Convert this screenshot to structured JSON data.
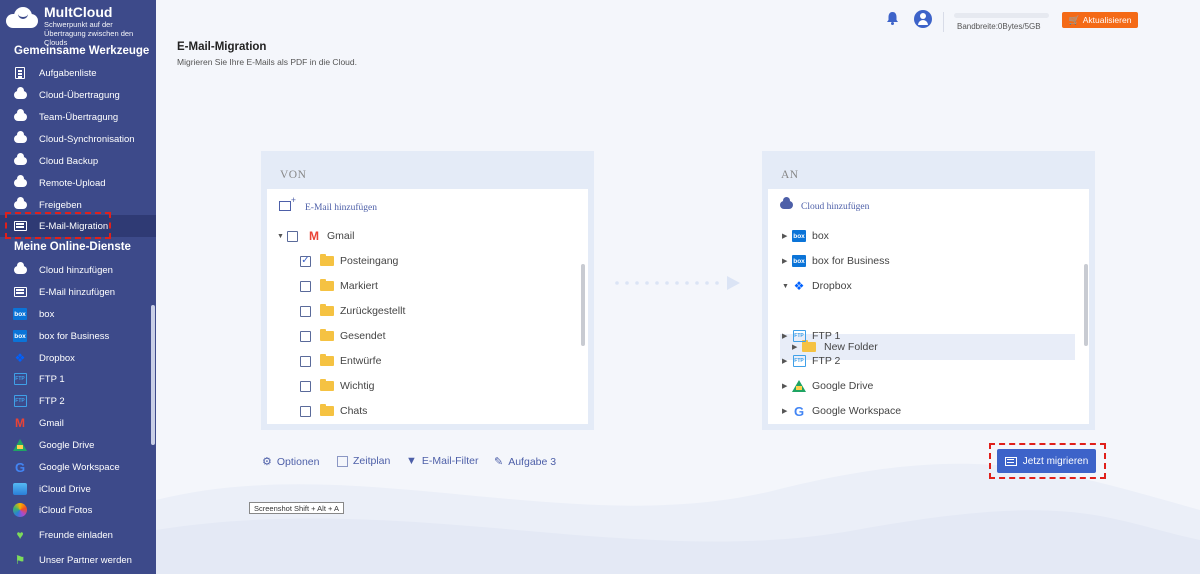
{
  "app": {
    "logo_title": "MultCloud",
    "logo_subtitle": "Schwerpunkt auf der Übertragung zwischen den Clouds"
  },
  "sidebar": {
    "section1_title": "Gemeinsame Werkzeuge",
    "tools": [
      {
        "label": "Aufgabenliste",
        "icon": "task-list-icon"
      },
      {
        "label": "Cloud-Übertragung",
        "icon": "cloud-transfer-icon"
      },
      {
        "label": "Team-Übertragung",
        "icon": "team-transfer-icon"
      },
      {
        "label": "Cloud-Synchronisation",
        "icon": "cloud-sync-icon"
      },
      {
        "label": "Cloud Backup",
        "icon": "cloud-backup-icon"
      },
      {
        "label": "Remote-Upload",
        "icon": "remote-upload-icon"
      },
      {
        "label": "Freigeben",
        "icon": "share-icon"
      },
      {
        "label": "E-Mail-Migration",
        "icon": "email-migration-icon",
        "active": true
      }
    ],
    "section2_title": "Meine Online-Dienste",
    "services": [
      {
        "label": "Cloud hinzufügen",
        "icon": "add-cloud-icon"
      },
      {
        "label": "E-Mail hinzufügen",
        "icon": "add-email-icon"
      },
      {
        "label": "box",
        "icon": "box-icon"
      },
      {
        "label": "box for Business",
        "icon": "box-business-icon"
      },
      {
        "label": "Dropbox",
        "icon": "dropbox-icon"
      },
      {
        "label": "FTP 1",
        "icon": "ftp-icon"
      },
      {
        "label": "FTP 2",
        "icon": "ftp-icon"
      },
      {
        "label": "Gmail",
        "icon": "gmail-icon"
      },
      {
        "label": "Google Drive",
        "icon": "google-drive-icon"
      },
      {
        "label": "Google Workspace",
        "icon": "google-workspace-icon"
      },
      {
        "label": "iCloud Drive",
        "icon": "icloud-drive-icon"
      },
      {
        "label": "iCloud Fotos",
        "icon": "icloud-photos-icon"
      }
    ],
    "footer": [
      {
        "label": "Freunde einladen",
        "icon": "gift-icon"
      },
      {
        "label": "Unser Partner werden",
        "icon": "partner-icon"
      }
    ]
  },
  "header": {
    "bandwidth_label": "Bandbreite:0Bytes/5GB",
    "bandwidth_used_fraction": 0,
    "upgrade_label": "Aktualisieren"
  },
  "page": {
    "title": "E-Mail-Migration",
    "subtitle": "Migrieren Sie Ihre E-Mails als PDF in die Cloud."
  },
  "from_panel": {
    "header": "VON",
    "add_label": "E-Mail hinzufügen",
    "root": "Gmail",
    "folders": [
      {
        "label": "Posteingang",
        "checked": true
      },
      {
        "label": "Markiert",
        "checked": false
      },
      {
        "label": "Zurückgestellt",
        "checked": false
      },
      {
        "label": "Gesendet",
        "checked": false
      },
      {
        "label": "Entwürfe",
        "checked": false
      },
      {
        "label": "Wichtig",
        "checked": false
      },
      {
        "label": "Chats",
        "checked": false
      }
    ]
  },
  "to_panel": {
    "header": "AN",
    "add_label": "Cloud hinzufügen",
    "items": [
      {
        "label": "box",
        "icon": "box-icon"
      },
      {
        "label": "box for Business",
        "icon": "box-icon"
      },
      {
        "label": "Dropbox",
        "icon": "dropbox-icon",
        "expanded": true
      },
      {
        "label": "New Folder",
        "icon": "folder-icon",
        "selected": true
      },
      {
        "label": "FTP 1",
        "icon": "ftp-icon"
      },
      {
        "label": "FTP 2",
        "icon": "ftp-icon"
      },
      {
        "label": "Google Drive",
        "icon": "google-drive-icon"
      },
      {
        "label": "Google Workspace",
        "icon": "google-workspace-icon"
      }
    ]
  },
  "options": {
    "options_label": "Optionen",
    "schedule_label": "Zeitplan",
    "filter_label": "E-Mail-Filter",
    "task_label": "Aufgabe 3"
  },
  "migrate_button": "Jetzt migrieren",
  "tooltip": "Screenshot Shift + Alt + A",
  "colors": {
    "sidebar_bg": "#3d4a8a",
    "accent": "#3d63c9",
    "upgrade": "#f46a16",
    "highlight": "#e0201b"
  }
}
